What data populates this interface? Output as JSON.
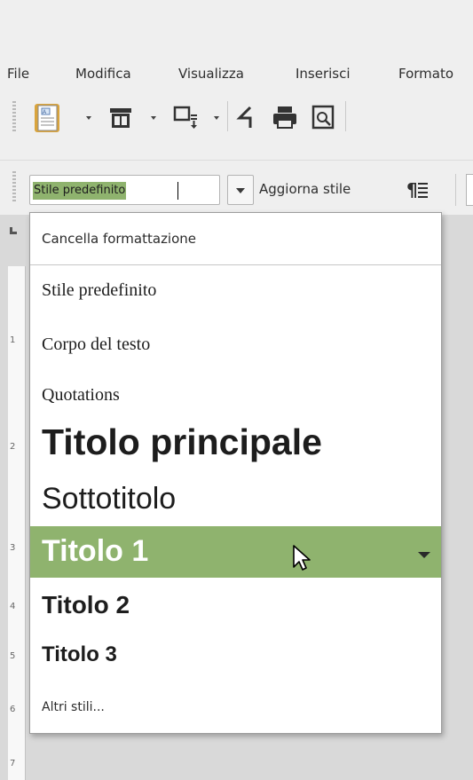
{
  "menubar": {
    "items": [
      "File",
      "Modifica",
      "Visualizza",
      "Inserisci",
      "Formato"
    ]
  },
  "toolbar": {
    "icons": [
      "template-document-icon",
      "insert-table-icon",
      "insert-field-icon",
      "send-icon",
      "print-icon",
      "print-preview-icon"
    ]
  },
  "style_bar": {
    "current_style": "Stile predefinito",
    "update_style_label": "Aggiorna stile",
    "paragraph_icon": "¶"
  },
  "style_menu": {
    "clear_formatting": "Cancella formattazione",
    "items": [
      {
        "label": "Stile predefinito"
      },
      {
        "label": "Corpo del testo"
      },
      {
        "label": "Quotations"
      },
      {
        "label": "Titolo principale"
      },
      {
        "label": "Sottotitolo"
      },
      {
        "label": "Titolo 1",
        "selected": true
      },
      {
        "label": "Titolo 2"
      },
      {
        "label": "Titolo 3"
      }
    ],
    "more_styles": "Altri stili...",
    "highlight_color": "#8fb36e"
  },
  "ruler": {
    "numbers": [
      "1",
      "2",
      "3",
      "4",
      "5",
      "6",
      "7"
    ]
  }
}
